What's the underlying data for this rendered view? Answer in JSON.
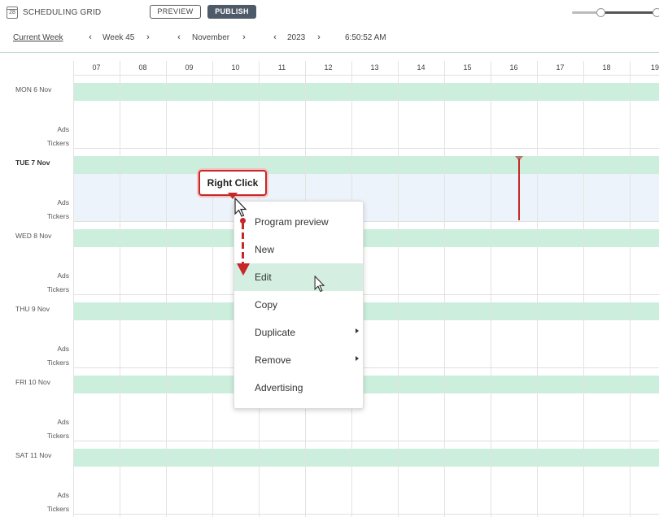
{
  "app": {
    "title": "SCHEDULING GRID",
    "icon_text": "28",
    "preview_label": "PREVIEW",
    "publish_label": "PUBLISH"
  },
  "zoom_slider": {
    "low": 0.33,
    "high": 1.0
  },
  "nav": {
    "current_week": "Current Week",
    "week": "Week 45",
    "month": "November",
    "year": "2023",
    "time": "6:50:52 AM"
  },
  "hours": [
    "07",
    "08",
    "09",
    "10",
    "11",
    "12",
    "13",
    "14",
    "15",
    "16",
    "17",
    "18",
    "19"
  ],
  "days": [
    {
      "label": "MON 6 Nov",
      "ads": "Ads",
      "tickers": "Tickers"
    },
    {
      "label": "TUE 7 Nov",
      "ads": "Ads",
      "tickers": "Tickers"
    },
    {
      "label": "WED 8 Nov",
      "ads": "Ads",
      "tickers": "Tickers"
    },
    {
      "label": "THU 9 Nov",
      "ads": "Ads",
      "tickers": "Tickers"
    },
    {
      "label": "FRI 10 Nov",
      "ads": "Ads",
      "tickers": "Tickers"
    },
    {
      "label": "SAT 11 Nov",
      "ads": "Ads",
      "tickers": "Tickers"
    }
  ],
  "context_menu": {
    "items": [
      {
        "label": "Program preview"
      },
      {
        "label": "New"
      },
      {
        "label": "Edit"
      },
      {
        "label": "Copy"
      },
      {
        "label": "Duplicate"
      },
      {
        "label": "Remove"
      },
      {
        "label": "Advertising"
      }
    ]
  },
  "annotation": {
    "callout": "Right Click"
  },
  "colors": {
    "band": "#cceedd",
    "now_line": "#c62828",
    "publish_bg": "#4f5a68",
    "menu_active": "#d4efe1"
  }
}
